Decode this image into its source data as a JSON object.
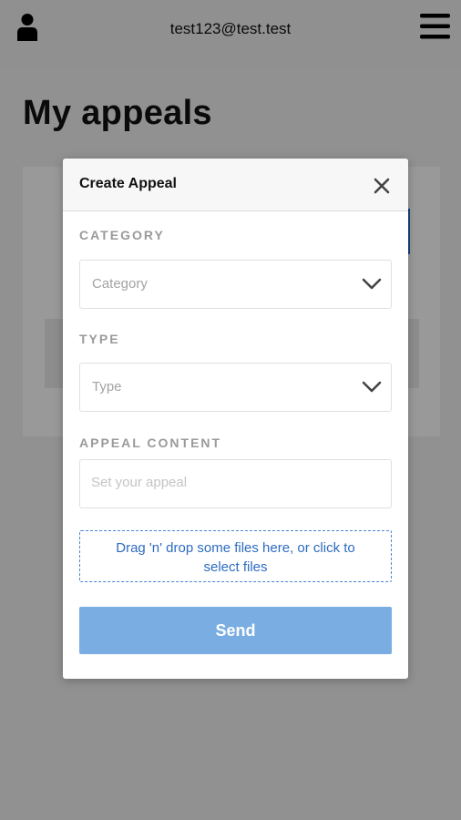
{
  "header": {
    "user_icon": "user-icon",
    "email": "test123@test.test",
    "menu_icon": "hamburger-menu-icon"
  },
  "page": {
    "title": "My appeals"
  },
  "modal": {
    "title": "Create Appeal",
    "close_icon": "close-icon",
    "category": {
      "label": "CATEGORY",
      "value": "Category"
    },
    "type": {
      "label": "TYPE",
      "value": "Type"
    },
    "content": {
      "label": "APPEAL CONTENT",
      "placeholder": "Set your appeal"
    },
    "dropzone": {
      "line1": "Drag 'n' drop some files here, or click to",
      "line2": "select files"
    },
    "send_label": "Send"
  },
  "colors": {
    "accent": "#2f6fd0",
    "send_button": "#7aaee2",
    "dropzone_text": "#2d6cc0"
  }
}
